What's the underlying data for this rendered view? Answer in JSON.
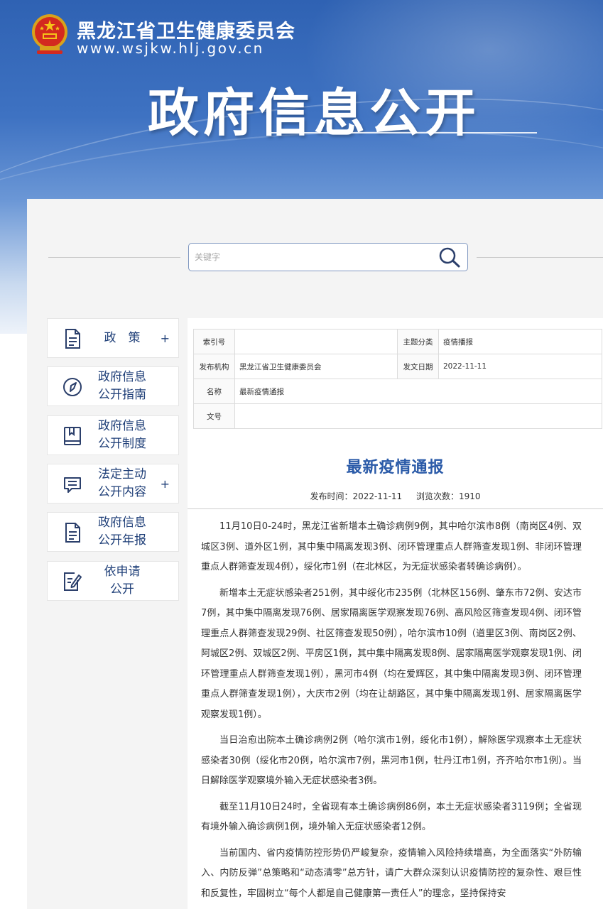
{
  "header": {
    "site_name": "黑龙江省卫生健康委员会",
    "site_url": "www.wsjkw.hlj.gov.cn",
    "banner_title": "政府信息公开"
  },
  "search": {
    "placeholder": "关键字"
  },
  "sidebar": {
    "items": [
      {
        "label": "政　策",
        "icon": "document-icon",
        "expandable": true
      },
      {
        "label": "政府信息\n公开指南",
        "icon": "compass-icon",
        "expandable": false
      },
      {
        "label": "政府信息\n公开制度",
        "icon": "book-icon",
        "expandable": false
      },
      {
        "label": "法定主动\n公开内容",
        "icon": "chat-list-icon",
        "expandable": true
      },
      {
        "label": "政府信息\n公开年报",
        "icon": "report-icon",
        "expandable": false
      },
      {
        "label": "依申请\n公开",
        "icon": "edit-form-icon",
        "expandable": false
      }
    ],
    "plus_symbol": "+"
  },
  "meta": {
    "index_label": "索引号",
    "index_value": "",
    "topic_label": "主题分类",
    "topic_value": "疫情播报",
    "publisher_label": "发布机构",
    "publisher_value": "黑龙江省卫生健康委员会",
    "date_label": "发文日期",
    "date_value": "2022-11-11",
    "name_label": "名称",
    "name_value": "最新疫情通报",
    "docno_label": "文号",
    "docno_value": ""
  },
  "article": {
    "title": "最新疫情通报",
    "publish_time": "发布时间：2022-11-11",
    "views": "浏览次数：1910",
    "paragraphs": [
      "11月10日0-24时，黑龙江省新增本土确诊病例9例，其中哈尔滨市8例（南岗区4例、双城区3例、道外区1例，其中集中隔离发现3例、闭环管理重点人群筛查发现1例、非闭环管理重点人群筛查发现4例），绥化市1例（在北林区，为无症状感染者转确诊病例）。",
      "新增本土无症状感染者251例，其中绥化市235例（北林区156例、肇东市72例、安达市7例，其中集中隔离发现76例、居家隔离医学观察发现76例、高风险区筛查发现4例、闭环管理重点人群筛查发现29例、社区筛查发现50例），哈尔滨市10例（道里区3例、南岗区2例、阿城区2例、双城区2例、平房区1例，其中集中隔离发现8例、居家隔离医学观察发现1例、闭环管理重点人群筛查发现1例），黑河市4例（均在爱辉区，其中集中隔离发现3例、闭环管理重点人群筛查发现1例），大庆市2例（均在让胡路区，其中集中隔离发现1例、居家隔离医学观察发现1例）。",
      "当日治愈出院本土确诊病例2例（哈尔滨市1例，绥化市1例），解除医学观察本土无症状感染者30例（绥化市20例，哈尔滨市7例，黑河市1例，牡丹江市1例，齐齐哈尔市1例）。当日解除医学观察境外输入无症状感染者3例。",
      "截至11月10日24时，全省现有本土确诊病例86例，本土无症状感染者3119例；全省现有境外输入确诊病例1例，境外输入无症状感染者12例。",
      "当前国内、省内疫情防控形势仍严峻复杂，疫情输入风险持续增高，为全面落实“外防输入、内防反弹”总策略和“动态清零”总方针，请广大群众深刻认识疫情防控的复杂性、艰巨性和反复性，牢固树立“每个人都是自己健康第一责任人”的理念，坚持保持安"
    ]
  }
}
